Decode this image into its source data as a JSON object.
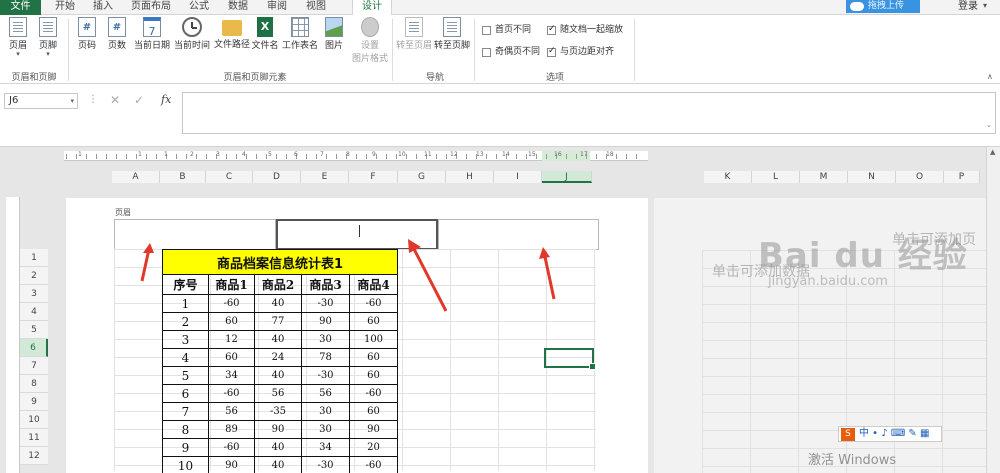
{
  "tabs": {
    "file": "文件",
    "home": "开始",
    "insert": "插入",
    "page_layout": "页面布局",
    "formulas": "公式",
    "data": "数据",
    "review": "审阅",
    "view": "视图",
    "design": "设计"
  },
  "top_right": {
    "upload": "拖拽上传",
    "login": "登录",
    "login_caret": "▾"
  },
  "ribbon": {
    "header": "页眉",
    "footer": "页脚",
    "page_number": "页码",
    "page_count": "页数",
    "current_date": "当前日期",
    "current_time": "当前时间",
    "file_path": "文件路径",
    "file_name": "文件名",
    "sheet_name": "工作表名",
    "picture": "图片",
    "format_picture_line1": "设置",
    "format_picture_line2": "图片格式",
    "go_to_header": "转至页眉",
    "go_to_footer": "转至页脚",
    "group_header_footer": "页眉和页脚",
    "group_elements": "页眉和页脚元素",
    "group_nav": "导航",
    "group_options": "选项",
    "opt_first_page": "首页不同",
    "opt_odd_even": "奇偶页不同",
    "opt_scale_with_doc": "随文档一起缩放",
    "opt_align_margins": "与页边距对齐",
    "caret": "▾",
    "collapse": "∧"
  },
  "options_state": {
    "first_page": false,
    "odd_even": false,
    "scale_with_doc": true,
    "align_margins": true
  },
  "formula_bar": {
    "name_box": "J6",
    "dd": "▾",
    "dots": "⋮",
    "cancel": "✕",
    "enter": "✓",
    "fx": "fx",
    "expand": "⌄"
  },
  "ruler_numbers": [
    "1",
    "1",
    "1",
    "2",
    "3",
    "4",
    "5",
    "6",
    "7",
    "8",
    "9",
    "10",
    "11",
    "12",
    "13",
    "14",
    "15",
    "16",
    "17",
    "18"
  ],
  "columns": [
    "A",
    "B",
    "C",
    "D",
    "E",
    "F",
    "G",
    "H",
    "I",
    "J",
    "K",
    "L",
    "M",
    "N",
    "O",
    "P"
  ],
  "rows": [
    "1",
    "2",
    "3",
    "4",
    "5",
    "6",
    "7",
    "8",
    "9",
    "10",
    "11",
    "12"
  ],
  "header_area_label": "页眉",
  "table": {
    "title": "商品档案信息统计表1",
    "headers": [
      "序号",
      "商品1",
      "商品2",
      "商品3",
      "商品4"
    ],
    "rows": [
      [
        "1",
        "-60",
        "40",
        "-30",
        "-60"
      ],
      [
        "2",
        "60",
        "77",
        "90",
        "60"
      ],
      [
        "3",
        "12",
        "40",
        "30",
        "100"
      ],
      [
        "4",
        "60",
        "24",
        "78",
        "60"
      ],
      [
        "5",
        "34",
        "40",
        "-30",
        "60"
      ],
      [
        "6",
        "-60",
        "56",
        "56",
        "-60"
      ],
      [
        "7",
        "56",
        "-35",
        "30",
        "60"
      ],
      [
        "8",
        "89",
        "90",
        "30",
        "90"
      ],
      [
        "9",
        "-60",
        "40",
        "34",
        "20"
      ],
      [
        "10",
        "90",
        "40",
        "-30",
        "-60"
      ]
    ]
  },
  "page2": {
    "header_hint": "单击可添加页",
    "data_hint": "单击可添加数据"
  },
  "overlay": {
    "watermark_logo": "Bai du 经验",
    "watermark_url": "jingyan.baidu.com",
    "ime_label": "中 • ♪ ⌨ ✎ ▦",
    "ime_s": "S",
    "activate_windows": "激活 Windows"
  },
  "colors": {
    "accent": "#217346",
    "title_fill": "#ffff00",
    "arrow": "#e0392b",
    "upload": "#3a93e0"
  }
}
